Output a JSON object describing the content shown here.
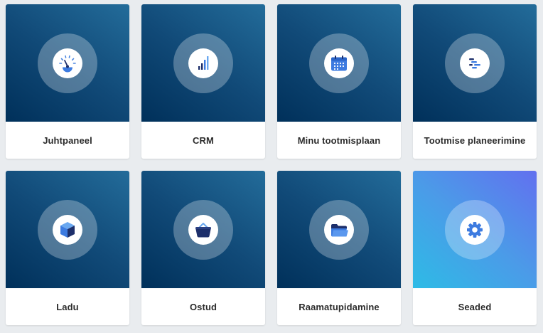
{
  "tiles": [
    {
      "label": "Juhtpaneel",
      "icon": "speedometer-icon"
    },
    {
      "label": "CRM",
      "icon": "bar-chart-icon"
    },
    {
      "label": "Minu tootmisplaan",
      "icon": "calendar-icon"
    },
    {
      "label": "Tootmise planeerimine",
      "icon": "gantt-icon"
    },
    {
      "label": "Ladu",
      "icon": "box-icon"
    },
    {
      "label": "Ostud",
      "icon": "basket-icon"
    },
    {
      "label": "Raamatupidamine",
      "icon": "folder-icon"
    },
    {
      "label": "Seaded",
      "icon": "gear-icon"
    }
  ],
  "colors": {
    "tile_gradient_dark": "#00305a",
    "tile_gradient_light": "#236c9a",
    "settings_gradient_start": "#2dbbe6",
    "settings_gradient_end": "#6270ef",
    "accent_blue": "#3d7be0",
    "navy": "#1d2f6b"
  }
}
